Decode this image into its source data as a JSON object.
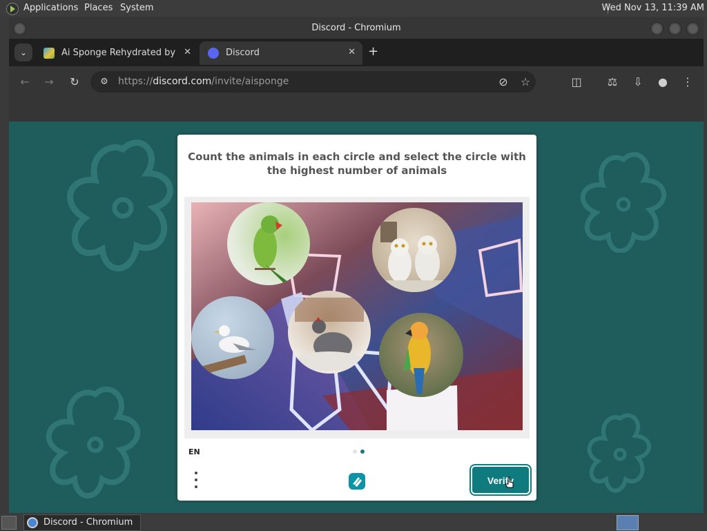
{
  "top_panel": {
    "menus": [
      "Applications",
      "Places",
      "System"
    ],
    "clock": "Wed Nov 13, 11:39 AM"
  },
  "window": {
    "title": "Discord - Chromium"
  },
  "tabs": [
    {
      "label": "Ai Sponge Rehydrated by Po",
      "favicon": "aisponge-favicon",
      "active": false
    },
    {
      "label": "Discord",
      "favicon": "discord-favicon",
      "active": true
    }
  ],
  "address_bar": {
    "scheme": "https://",
    "host": "discord.com",
    "path": "/invite/aisponge"
  },
  "captcha": {
    "prompt": "Count the animals in each circle and select the circle with the highest number of animals",
    "language": "EN",
    "verify_label": "Verify",
    "page_dots": [
      {
        "active": false
      },
      {
        "active": true
      }
    ],
    "circles": [
      {
        "id": "parakeet",
        "animals": "green parakeet"
      },
      {
        "id": "owls",
        "animals": "two snowy owls"
      },
      {
        "id": "seagull",
        "animals": "seagull"
      },
      {
        "id": "hen",
        "animals": "grey hen"
      },
      {
        "id": "macaw",
        "animals": "macaw"
      }
    ]
  },
  "taskbar": {
    "task_label": "Discord - Chromium"
  },
  "colors": {
    "page_bg": "#1f5d5c",
    "verify_bg": "#0f7b7e",
    "dot_active": "#1a7a7a"
  }
}
